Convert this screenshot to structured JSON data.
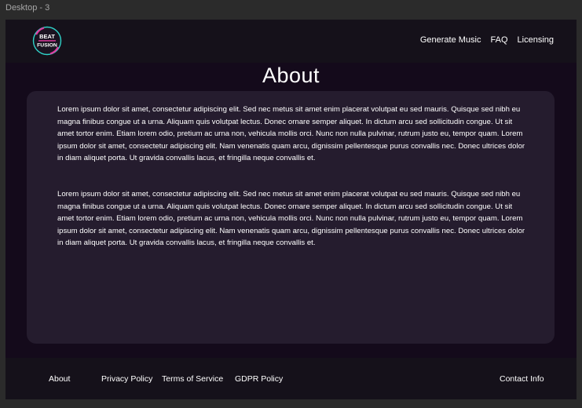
{
  "frame_label": "Desktop - 3",
  "header": {
    "logo": {
      "line1": "BEAT",
      "line2": "FUSION"
    },
    "nav": [
      "Generate Music",
      "FAQ",
      "Licensing"
    ]
  },
  "main": {
    "title": "About",
    "paragraphs": [
      "Lorem ipsum dolor sit amet, consectetur adipiscing elit. Sed nec metus sit amet enim placerat volutpat eu sed mauris. Quisque sed nibh eu magna finibus congue ut a urna. Aliquam quis volutpat lectus. Donec ornare semper aliquet. In dictum arcu sed sollicitudin congue. Ut sit amet tortor enim. Etiam lorem odio, pretium ac urna non, vehicula mollis orci. Nunc non nulla pulvinar, rutrum justo eu, tempor quam. Lorem ipsum dolor sit amet, consectetur adipiscing elit. Nam venenatis quam arcu, dignissim pellentesque purus convallis nec. Donec ultrices dolor in diam aliquet porta. Ut gravida convallis lacus, et fringilla neque convallis et.",
      "Lorem ipsum dolor sit amet, consectetur adipiscing elit. Sed nec metus sit amet enim placerat volutpat eu sed mauris. Quisque sed nibh eu magna finibus congue ut a urna. Aliquam quis volutpat lectus. Donec ornare semper aliquet. In dictum arcu sed sollicitudin congue. Ut sit amet tortor enim. Etiam lorem odio, pretium ac urna non, vehicula mollis orci. Nunc non nulla pulvinar, rutrum justo eu, tempor quam. Lorem ipsum dolor sit amet, consectetur adipiscing elit. Nam venenatis quam arcu, dignissim pellentesque purus convallis nec. Donec ultrices dolor in diam aliquet porta. Ut gravida convallis lacus, et fringilla neque convallis et."
    ]
  },
  "footer": {
    "links": [
      "About",
      "Privacy Policy",
      "Terms of Service",
      "GDPR Policy"
    ],
    "contact": "Contact Info"
  },
  "colors": {
    "background": "#140a1b",
    "header_footer": "#15111a",
    "card": "#251c2e",
    "text": "#ffffff",
    "logo_pink": "#e23aa0",
    "logo_teal": "#2fd2c8"
  }
}
